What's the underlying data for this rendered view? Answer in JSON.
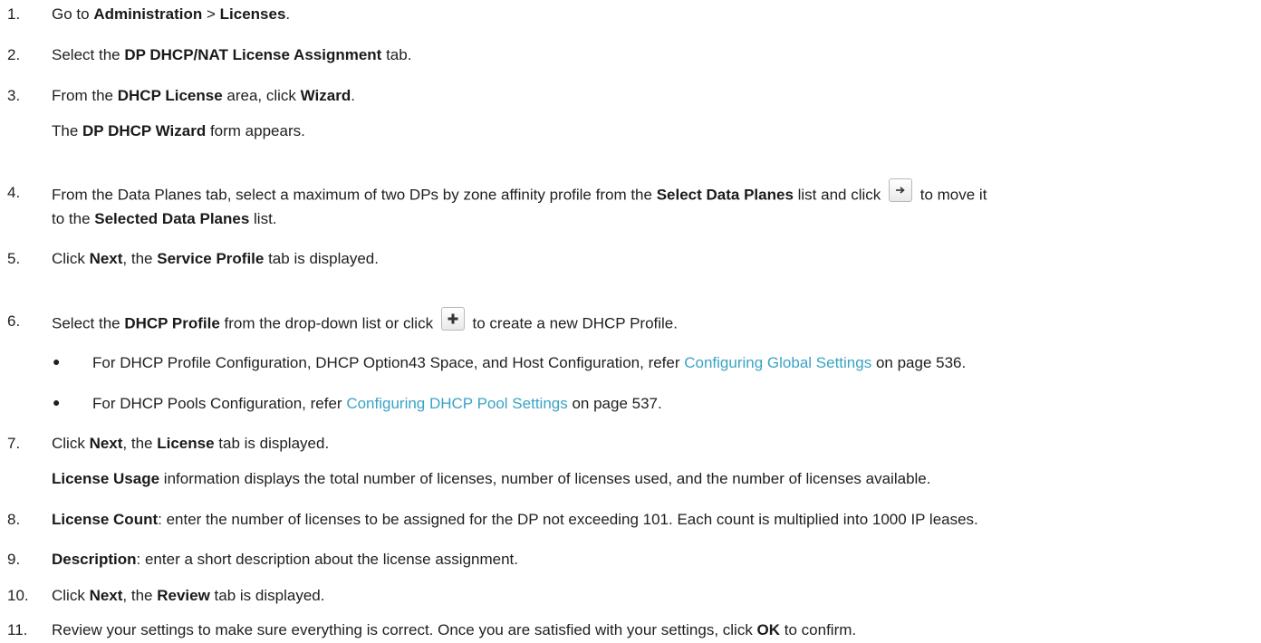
{
  "steps": [
    {
      "num": "1.",
      "parts": [
        "Go to ",
        "Administration",
        " > ",
        "Licenses",
        "."
      ]
    },
    {
      "num": "2.",
      "parts": [
        "Select the ",
        "DP DHCP/NAT License Assignment",
        " tab."
      ]
    },
    {
      "num": "3.",
      "parts": [
        "From the ",
        "DHCP License",
        " area, click ",
        "Wizard",
        "."
      ]
    },
    {
      "note": [
        "The ",
        "DP DHCP Wizard",
        " form appears."
      ]
    },
    {
      "num": "4.",
      "parts": [
        "From the Data Planes tab, select a maximum of two DPs by zone affinity profile from the ",
        "Select Data Planes",
        " list and click ",
        " to move it"
      ],
      "line2": [
        "to the ",
        "Selected Data Planes",
        " list."
      ]
    },
    {
      "num": "5.",
      "parts": [
        "Click ",
        "Next",
        ", the ",
        "Service Profile",
        " tab is displayed."
      ]
    },
    {
      "num": "6.",
      "parts": [
        "Select the ",
        "DHCP Profile",
        " from the drop-down list or click ",
        " to create a new DHCP Profile."
      ]
    },
    {
      "bullets": [
        {
          "bullet": "●",
          "text": "For DHCP Profile Configuration, DHCP Option43 Space, and Host Configuration, refer ",
          "link": "Configuring Global Settings",
          "after": " on page 536."
        },
        {
          "bullet": "●",
          "text": "For DHCP Pools Configuration, refer ",
          "link": "Configuring DHCP Pool Settings",
          "after": " on page 537."
        }
      ]
    },
    {
      "num": "7.",
      "parts": [
        "Click ",
        "Next",
        ", the ",
        "License",
        " tab is displayed."
      ]
    },
    {
      "note": [
        "License Usage",
        " information displays the total number of licenses, number of licenses used, and the number of licenses available."
      ]
    },
    {
      "num": "8.",
      "parts": [
        "License Count",
        ": enter the number of licenses to be assigned for the DP not exceeding 101. Each count is multiplied into 1000 IP leases."
      ]
    },
    {
      "num": "9.",
      "parts": [
        "Description",
        ": enter a short description about the license assignment."
      ]
    },
    {
      "num": "10.",
      "parts": [
        "Click ",
        "Next",
        ", the ",
        "Review",
        " tab is displayed."
      ]
    },
    {
      "num": "11.",
      "parts": [
        "Review your settings to make sure everything is correct. Once you are satisfied with your settings, click ",
        "OK",
        " to confirm."
      ]
    }
  ],
  "icons": {
    "move": "arrow-right-icon",
    "add": "plus-icon"
  },
  "colors": {
    "link": "#3aa3c4",
    "text": "#1f1f1f"
  }
}
